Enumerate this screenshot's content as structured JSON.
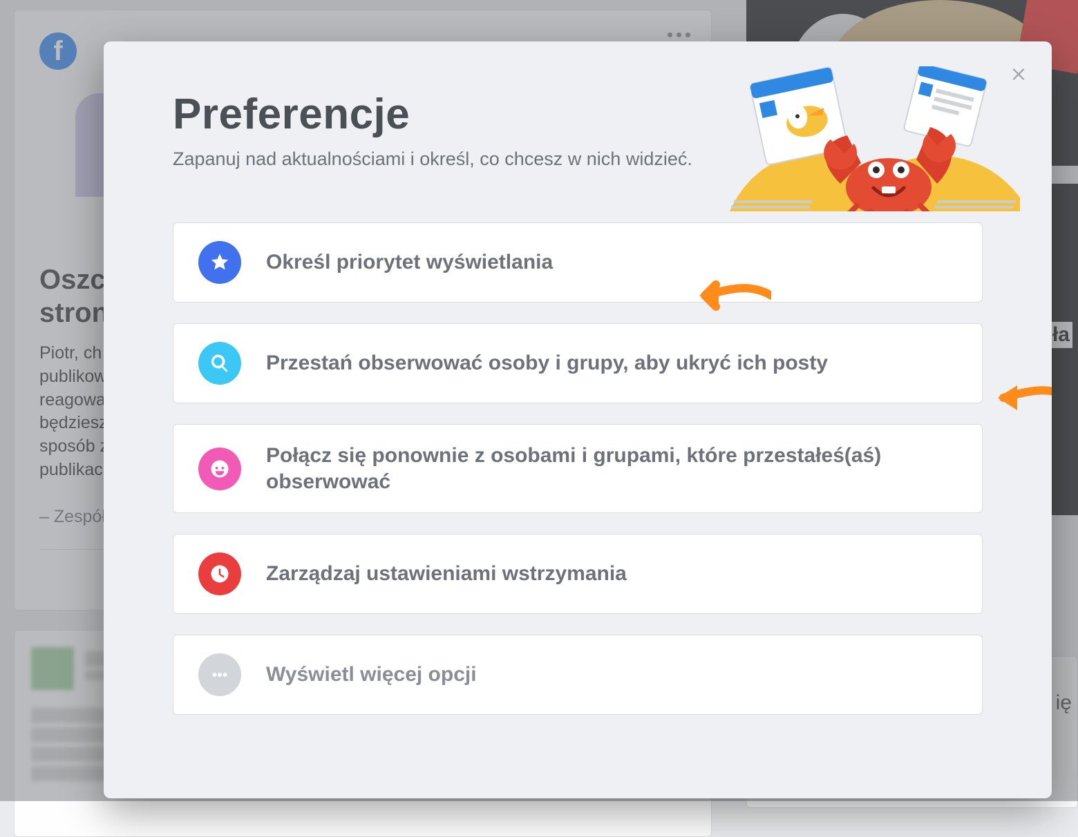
{
  "background": {
    "dots_aria": "Więcej opcji",
    "heading_line1": "Oszcz",
    "heading_line2": "stronie",
    "body_line1": "Piotr, ch",
    "body_line2": "publikow",
    "body_line3": "reagowa",
    "body_line4": "będziesz",
    "body_line5": "sposób z",
    "body_line6": "publikac",
    "signature": "– Zespół F",
    "right_label1": "ła",
    "right_label2": "ię"
  },
  "modal": {
    "title": "Preferencje",
    "subtitle": "Zapanuj nad aktualnościami i określ, co chcesz w nich widzieć.",
    "close_aria": "Zamknij",
    "options": [
      {
        "label": "Określ priorytet wyświetlania"
      },
      {
        "label": "Przestań obserwować osoby i grupy, aby ukryć ich posty"
      },
      {
        "label": "Połącz się ponownie z osobami i grupami, które przestałeś(aś) obserwować"
      },
      {
        "label": "Zarządzaj ustawieniami wstrzymania"
      },
      {
        "label": "Wyświetl więcej opcji"
      }
    ]
  }
}
